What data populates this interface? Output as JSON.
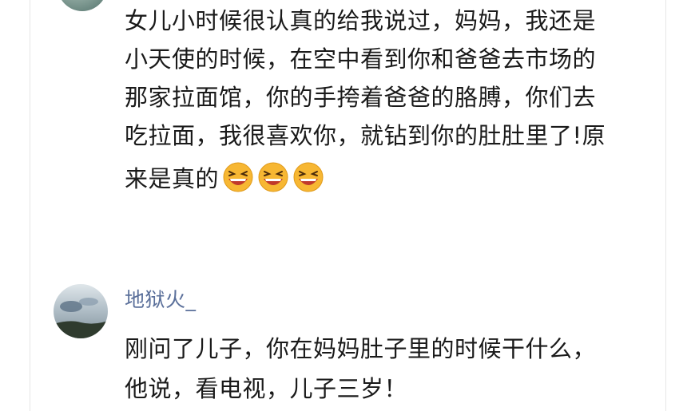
{
  "comments": [
    {
      "text_lines": [
        "女儿小时候很认真的给我说过，妈妈，我还是",
        "小天使的时候，在空中看到你和爸爸去市场的",
        "那家拉面馆，你的手挎着爸爸的胳膊，你们去",
        "吃拉面，我很喜欢你，就钻到你的肚肚里了!原"
      ],
      "last_line": "来是真的",
      "emojis": [
        "laughing-emoji-icon",
        "laughing-emoji-icon",
        "laughing-emoji-icon"
      ]
    },
    {
      "username": "地狱火_",
      "text_lines": [
        "刚问了儿子，你在妈妈肚子里的时候干什么，",
        "他说，看电视，儿子三岁！"
      ]
    }
  ],
  "colors": {
    "username": "#5a6f9a",
    "text": "#1a1a1a",
    "emoji_face": "#f7b733",
    "emoji_mouth": "#c0392b"
  }
}
